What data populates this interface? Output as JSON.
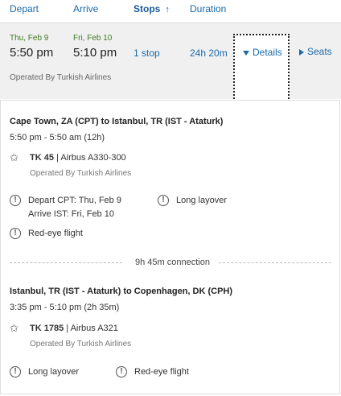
{
  "header": {
    "depart": "Depart",
    "arrive": "Arrive",
    "stops": "Stops",
    "stops_sort_icon": "arrow-up-icon",
    "duration": "Duration"
  },
  "summary": {
    "depart_date": "Thu, Feb 9",
    "depart_time": "5:50 pm",
    "arrive_date": "Fri, Feb 10",
    "arrive_time": "5:10 pm",
    "stops": "1 stop",
    "duration": "24h 20m",
    "details_label": "Details",
    "seats_label": "Seats",
    "operated_by": "Operated By Turkish Airlines"
  },
  "segments": [
    {
      "route": "Cape Town, ZA (CPT) to Istanbul, TR (IST - Ataturk)",
      "times": "5:50 pm - 5:50 am (12h)",
      "flight_number": "TK 45",
      "separator": "|",
      "aircraft": "Airbus A330-300",
      "operated_by": "Operated By Turkish Airlines",
      "notices": [
        "Depart CPT: Thu, Feb 9",
        "Arrive IST: Fri, Feb 10",
        "Long layover",
        "Red-eye flight"
      ]
    },
    {
      "route": "Istanbul, TR (IST - Ataturk) to Copenhagen, DK (CPH)",
      "times": "3:35 pm - 5:10 pm (2h 35m)",
      "flight_number": "TK 1785",
      "separator": "|",
      "aircraft": "Airbus A321",
      "operated_by": "Operated By Turkish Airlines",
      "notices": [
        "Long layover",
        "Red-eye flight"
      ]
    }
  ],
  "connection": "9h 45m connection",
  "colors": {
    "link": "#1a6aaa",
    "date_green": "#3e7a1f",
    "summary_bg": "#f0f0f0"
  }
}
